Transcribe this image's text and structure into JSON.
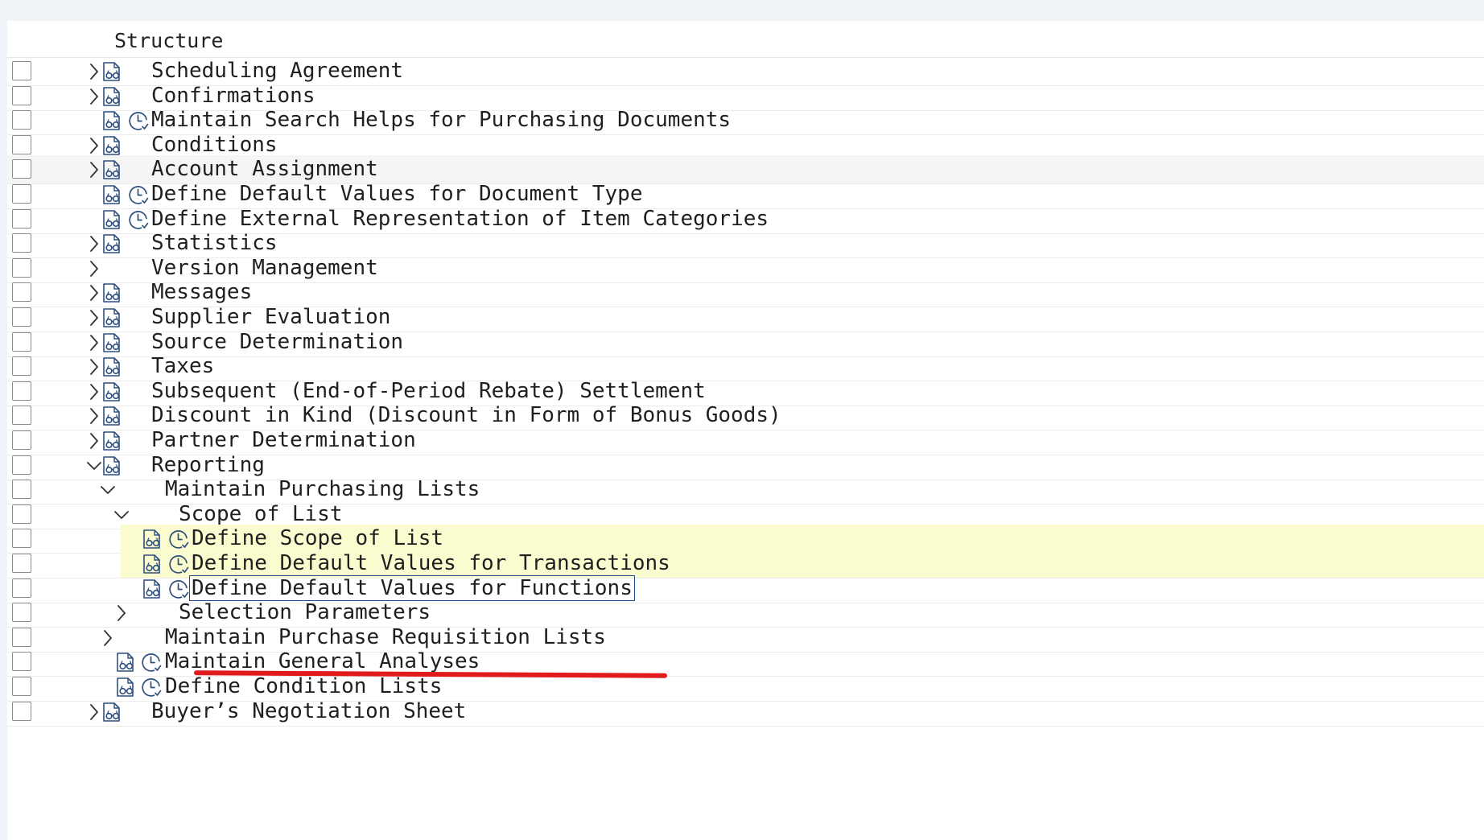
{
  "tree": {
    "header": "Structure",
    "rows": [
      {
        "label": "Scheduling Agreement",
        "level": 0,
        "expander": "collapsed",
        "doc": true,
        "clock": false
      },
      {
        "label": "Confirmations",
        "level": 0,
        "expander": "collapsed",
        "doc": true,
        "clock": false
      },
      {
        "label": "Maintain Search Helps for Purchasing Documents",
        "level": 0,
        "expander": "none",
        "doc": true,
        "clock": true
      },
      {
        "label": "Conditions",
        "level": 0,
        "expander": "collapsed",
        "doc": true,
        "clock": false
      },
      {
        "label": "Account Assignment",
        "level": 0,
        "expander": "collapsed",
        "doc": true,
        "clock": false,
        "hover": true
      },
      {
        "label": "Define Default Values for Document Type",
        "level": 0,
        "expander": "none",
        "doc": true,
        "clock": true
      },
      {
        "label": "Define External Representation of Item Categories",
        "level": 0,
        "expander": "none",
        "doc": true,
        "clock": true
      },
      {
        "label": "Statistics",
        "level": 0,
        "expander": "collapsed",
        "doc": true,
        "clock": false
      },
      {
        "label": "Version Management",
        "level": 0,
        "expander": "collapsed",
        "doc": false,
        "clock": false
      },
      {
        "label": "Messages",
        "level": 0,
        "expander": "collapsed",
        "doc": true,
        "clock": false
      },
      {
        "label": "Supplier Evaluation",
        "level": 0,
        "expander": "collapsed",
        "doc": true,
        "clock": false
      },
      {
        "label": "Source Determination",
        "level": 0,
        "expander": "collapsed",
        "doc": true,
        "clock": false
      },
      {
        "label": "Taxes",
        "level": 0,
        "expander": "collapsed",
        "doc": true,
        "clock": false
      },
      {
        "label": "Subsequent (End-of-Period Rebate) Settlement",
        "level": 0,
        "expander": "collapsed",
        "doc": true,
        "clock": false
      },
      {
        "label": "Discount in Kind (Discount in Form of Bonus Goods)",
        "level": 0,
        "expander": "collapsed",
        "doc": true,
        "clock": false
      },
      {
        "label": "Partner Determination",
        "level": 0,
        "expander": "collapsed",
        "doc": true,
        "clock": false
      },
      {
        "label": "Reporting",
        "level": 0,
        "expander": "expanded",
        "doc": true,
        "clock": false
      },
      {
        "label": "Maintain Purchasing Lists",
        "level": 1,
        "expander": "expanded",
        "doc": false,
        "clock": false
      },
      {
        "label": "Scope of List",
        "level": 2,
        "expander": "expanded",
        "doc": false,
        "clock": false
      },
      {
        "label": "Define Scope of List",
        "level": 3,
        "expander": "none",
        "doc": true,
        "clock": true,
        "highlight": true
      },
      {
        "label": "Define Default Values for Transactions",
        "level": 3,
        "expander": "none",
        "doc": true,
        "clock": true,
        "highlight": true
      },
      {
        "label": "Define Default Values for Functions",
        "level": 3,
        "expander": "none",
        "doc": true,
        "clock": true,
        "focused": true
      },
      {
        "label": "Selection Parameters",
        "level": 2,
        "expander": "collapsed",
        "doc": false,
        "clock": false
      },
      {
        "label": "Maintain Purchase Requisition Lists",
        "level": 1,
        "expander": "collapsed",
        "doc": false,
        "clock": false
      },
      {
        "label": "Maintain General Analyses",
        "level": 1,
        "expander": "none",
        "doc": true,
        "clock": true
      },
      {
        "label": "Define Condition Lists",
        "level": 1,
        "expander": "none",
        "doc": true,
        "clock": true
      },
      {
        "label": "Buyer’s Negotiation Sheet",
        "level": 0,
        "expander": "collapsed",
        "doc": true,
        "clock": false
      }
    ]
  },
  "annotation": {
    "color": "#e11b1b",
    "target": "Define Default Values for Transactions"
  },
  "colors": {
    "highlight": "#fbfbd0",
    "hover": "#f5f5f5",
    "focus_border": "#1f4e8c"
  },
  "icons": {
    "collapsed": "chevron-right-icon",
    "expanded": "chevron-down-icon",
    "doc": "document-glasses-icon",
    "clock": "clock-activity-icon"
  }
}
